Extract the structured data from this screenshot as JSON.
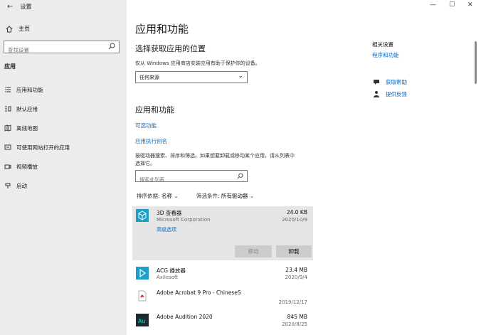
{
  "window": {
    "title": "设置",
    "minimize": "—",
    "maximize": "☐",
    "close": "✕"
  },
  "sidebar": {
    "home_label": "主页",
    "search_placeholder": "查找设置",
    "section_title": "应用",
    "items": [
      {
        "label": "应用和功能",
        "icon": "list-icon"
      },
      {
        "label": "默认应用",
        "icon": "default-apps-icon"
      },
      {
        "label": "离线地图",
        "icon": "map-icon"
      },
      {
        "label": "可使用网站打开的应用",
        "icon": "web-apps-icon"
      },
      {
        "label": "视频播放",
        "icon": "video-icon"
      },
      {
        "label": "启动",
        "icon": "startup-icon"
      }
    ]
  },
  "main": {
    "title": "应用和功能",
    "install_section": {
      "heading": "选择获取应用的位置",
      "description": "仅从 Windows 应用商店安装应用有助于保护你的设备。",
      "dropdown_value": "任何来源"
    },
    "apps_section": {
      "heading": "应用和功能",
      "link_optional_features": "可选功能",
      "link_app_aliases": "应用执行别名",
      "description_line1": "按驱动器搜索、排序和筛选。如果想要卸载或移动某个应用，请从列表中",
      "description_line2": "选择它。",
      "search_placeholder": "搜索此列表",
      "sort_label": "排序依据:",
      "sort_value": "名称",
      "filter_label": "筛选条件:",
      "filter_value": "所有驱动器"
    },
    "apps": [
      {
        "name": "3D 查看器",
        "publisher": "Microsoft Corporation",
        "size": "24.0 KB",
        "date": "2020/10/9",
        "advanced": "高级选项",
        "move": "移动",
        "uninstall": "卸载",
        "icon": "cube-icon",
        "color": "#1aa0c8"
      },
      {
        "name": "ACG 播放器",
        "publisher": "Axilesoft",
        "size": "23.4 MB",
        "date": "2020/9/4",
        "icon": "play-icon",
        "color": "#1aa0c8"
      },
      {
        "name": "Adobe Acrobat 9 Pro - ChineseS",
        "publisher": "",
        "size": "",
        "date": "2019/12/17",
        "icon": "pdf-icon",
        "color": "#d33"
      },
      {
        "name": "Adobe Audition 2020",
        "publisher": "",
        "size": "845 MB",
        "date": "2020/8/25",
        "icon": "audition-icon",
        "color": "#1b2b34"
      }
    ]
  },
  "related": {
    "title": "相关设置",
    "programs_features": "程序和功能",
    "get_help": "获取帮助",
    "feedback": "提供反馈"
  }
}
